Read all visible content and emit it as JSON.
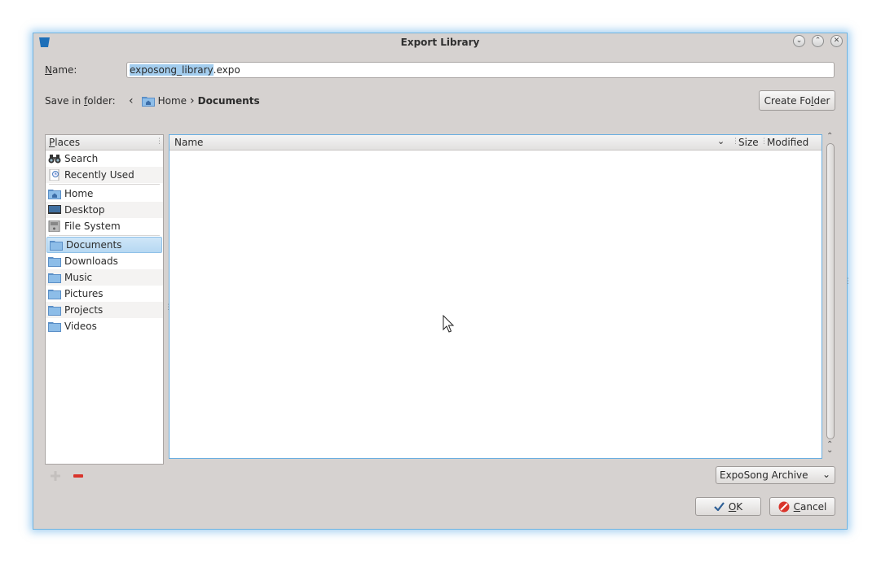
{
  "window": {
    "title": "Export Library"
  },
  "name_field": {
    "label": "Name:",
    "label_key": "N",
    "label_rest": "ame:",
    "value_selected": "exposong_library",
    "value_rest": ".expo"
  },
  "save_in": {
    "label_pre": "Save in ",
    "label_key": "f",
    "label_post": "older:",
    "crumbs": [
      "Home",
      "Documents"
    ]
  },
  "create_folder": {
    "pre": "Create Fo",
    "key": "l",
    "post": "der"
  },
  "places": {
    "header_key": "P",
    "header_rest": "laces",
    "items": [
      {
        "label": "Search",
        "icon": "binoculars-icon"
      },
      {
        "label": "Recently Used",
        "icon": "clock-icon"
      },
      {
        "label": "Home",
        "icon": "home-folder-icon"
      },
      {
        "label": "Desktop",
        "icon": "desktop-icon"
      },
      {
        "label": "File System",
        "icon": "drive-icon"
      },
      {
        "label": "Documents",
        "icon": "folder-icon"
      },
      {
        "label": "Downloads",
        "icon": "folder-icon"
      },
      {
        "label": "Music",
        "icon": "folder-icon"
      },
      {
        "label": "Pictures",
        "icon": "folder-icon"
      },
      {
        "label": "Projects",
        "icon": "folder-icon"
      },
      {
        "label": "Videos",
        "icon": "folder-icon"
      }
    ]
  },
  "file_columns": [
    "Name",
    "Size",
    "Modified"
  ],
  "filter": {
    "selected": "ExpoSong Archive"
  },
  "ok_button": {
    "key": "O",
    "rest": "K"
  },
  "cancel_button": {
    "key": "C",
    "rest": "ancel"
  },
  "colors": {
    "accent": "#6aaee0",
    "selection": "#a3cdee",
    "window_bg": "#d6d2d0",
    "remove_red": "#d9342b"
  }
}
